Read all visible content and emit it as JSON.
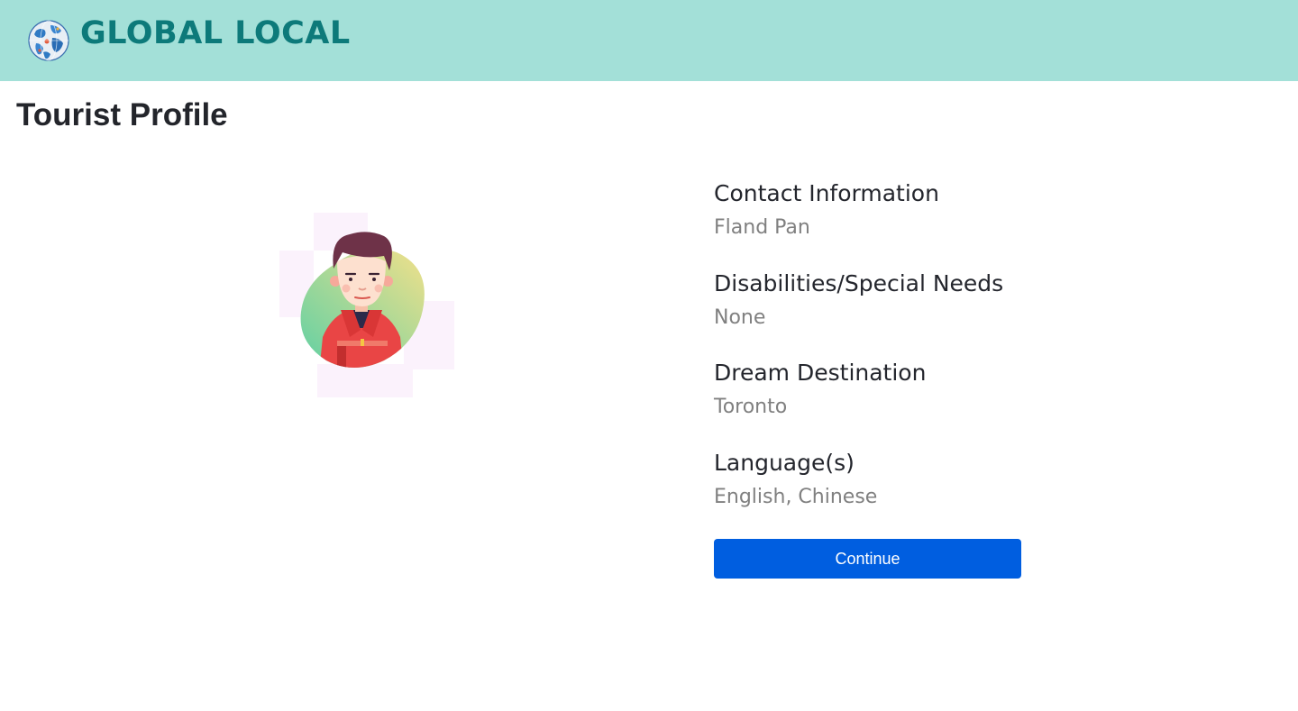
{
  "header": {
    "brand": "GLOBAL LOCAL",
    "logo_icon": "globe-icon",
    "background_color": "#a3e0d8",
    "brand_color": "#0d7a7a"
  },
  "page": {
    "title": "Tourist Profile"
  },
  "profile": {
    "avatar_icon": "tourist-avatar",
    "fields": [
      {
        "label": "Contact Information",
        "value": "Fland Pan"
      },
      {
        "label": "Disabilities/Special Needs",
        "value": "None"
      },
      {
        "label": "Dream Destination",
        "value": "Toronto"
      },
      {
        "label": "Language(s)",
        "value": "English, Chinese"
      }
    ]
  },
  "actions": {
    "continue_label": "Continue",
    "button_color": "#005ee0"
  }
}
